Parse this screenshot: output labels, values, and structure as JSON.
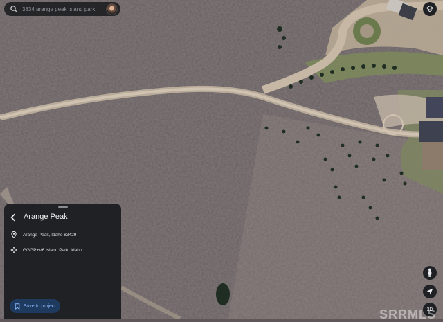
{
  "search": {
    "query": "3834 arange peak island park"
  },
  "place": {
    "title": "Arange Peak",
    "address": "Arange Peak, Idaho 83429",
    "plus_code": "GGGP+V6 Island Park, Idaho",
    "save_label": "Save to project"
  },
  "controls": {
    "view_mode": "3D"
  },
  "watermark": "SRRMLS",
  "colors": {
    "panel_bg": "#202124",
    "accent_blue": "#8ab4f8",
    "save_button_bg": "#1e3a5f"
  },
  "icons": {
    "search": "search-icon",
    "layers": "layers-icon",
    "back": "back-arrow-icon",
    "location": "location-pin-icon",
    "plus_code": "plus-code-icon",
    "bookmark": "bookmark-icon",
    "pegman": "pegman-icon",
    "compass": "compass-icon"
  }
}
